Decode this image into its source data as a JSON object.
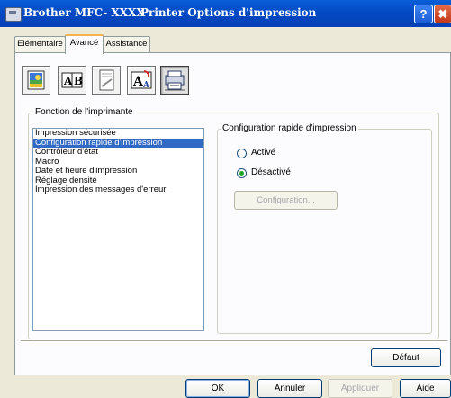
{
  "window": {
    "product": "Brother MFC- XXXX",
    "title": "Printer Options d'impression",
    "help_icon": "?",
    "close_icon": "✖"
  },
  "tabs": [
    {
      "label": "Elémentaire"
    },
    {
      "label": "Avancé"
    },
    {
      "label": "Assistance"
    }
  ],
  "toolbar_icons": [
    "quality-color-icon",
    "duplex-ab-icon",
    "watermark-icon",
    "scaling-a-icon",
    "printer-options-icon"
  ],
  "group": {
    "title": "Fonction de l'imprimante",
    "items": [
      "Impression sécurisée",
      "Configuration rapide d'impression",
      "Contrôleur d'état",
      "Macro",
      "Date et heure d'impression",
      "Réglage densité",
      "Impression des messages d'erreur"
    ],
    "selected_index": 1
  },
  "quick_setup": {
    "title": "Configuration rapide d'impression",
    "option_on": "Activé",
    "option_off": "Désactivé",
    "selected": "Désactivé",
    "config_button": "Configuration..."
  },
  "buttons": {
    "default": "Défaut",
    "ok": "OK",
    "cancel": "Annuler",
    "apply": "Appliquer",
    "help": "Aide"
  },
  "colors": {
    "titlebar": "#0a5fd8",
    "selection": "#316ac5",
    "active_tab_accent": "#f8b34c",
    "radio_dot": "#21a121"
  }
}
